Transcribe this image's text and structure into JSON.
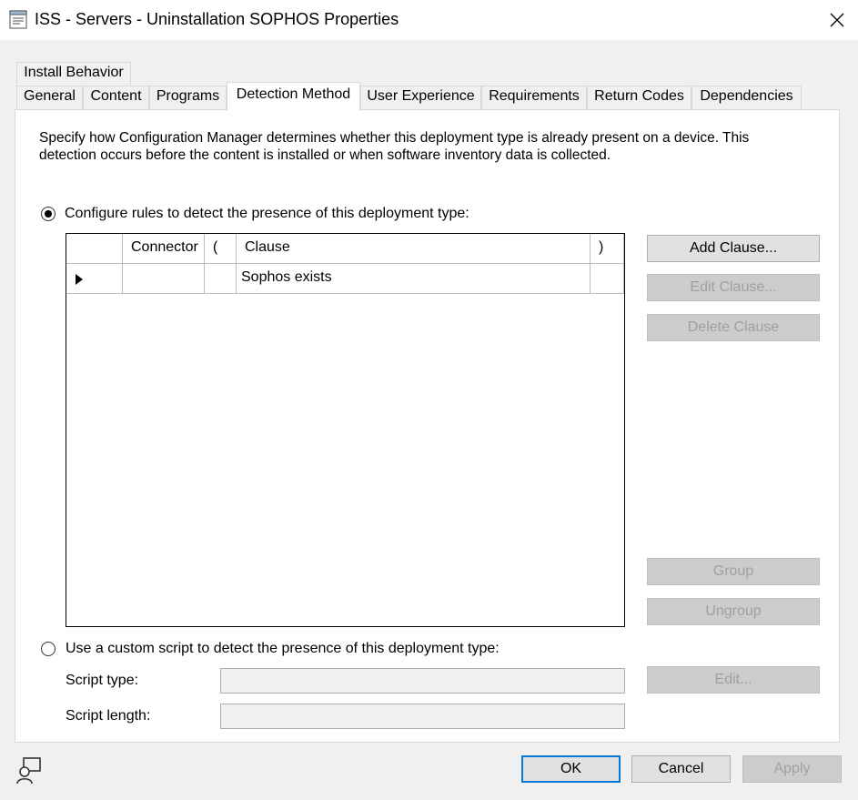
{
  "window": {
    "title": "ISS - Servers - Uninstallation SOPHOS Properties",
    "icons": {
      "app": "properties-icon",
      "close": "close-icon"
    }
  },
  "tabs_row_top": [
    {
      "label": "Install Behavior",
      "active": false
    }
  ],
  "tabs_row_bottom": [
    {
      "label": "General",
      "active": false
    },
    {
      "label": "Content",
      "active": false
    },
    {
      "label": "Programs",
      "active": false
    },
    {
      "label": "Detection Method",
      "active": true
    },
    {
      "label": "User Experience",
      "active": false
    },
    {
      "label": "Requirements",
      "active": false
    },
    {
      "label": "Return Codes",
      "active": false
    },
    {
      "label": "Dependencies",
      "active": false
    }
  ],
  "detection": {
    "description": "Specify how Configuration Manager determines whether this deployment type is already present on a device. This detection occurs before the content is installed or when software inventory data is collected.",
    "option_rules": {
      "label": "Configure rules to detect the presence of this deployment type:",
      "selected": true
    },
    "option_script": {
      "label": "Use a custom script to detect the presence of this deployment type:",
      "selected": false
    },
    "grid": {
      "columns": [
        "",
        "Connector",
        "(",
        "Clause",
        ")"
      ],
      "rows": [
        {
          "indicator": "row-pointer-icon",
          "connector": "",
          "open_paren": "",
          "clause": "Sophos exists",
          "close_paren": ""
        }
      ]
    },
    "buttons": {
      "add_clause": "Add Clause...",
      "edit_clause": "Edit Clause...",
      "delete_clause": "Delete Clause",
      "group": "Group",
      "ungroup": "Ungroup",
      "edit_script": "Edit..."
    },
    "script_type_label": "Script type:",
    "script_length_label": "Script length:",
    "script_type_value": "",
    "script_length_value": ""
  },
  "footer": {
    "ok": "OK",
    "cancel": "Cancel",
    "apply": "Apply",
    "icon": "user-feedback-icon"
  }
}
